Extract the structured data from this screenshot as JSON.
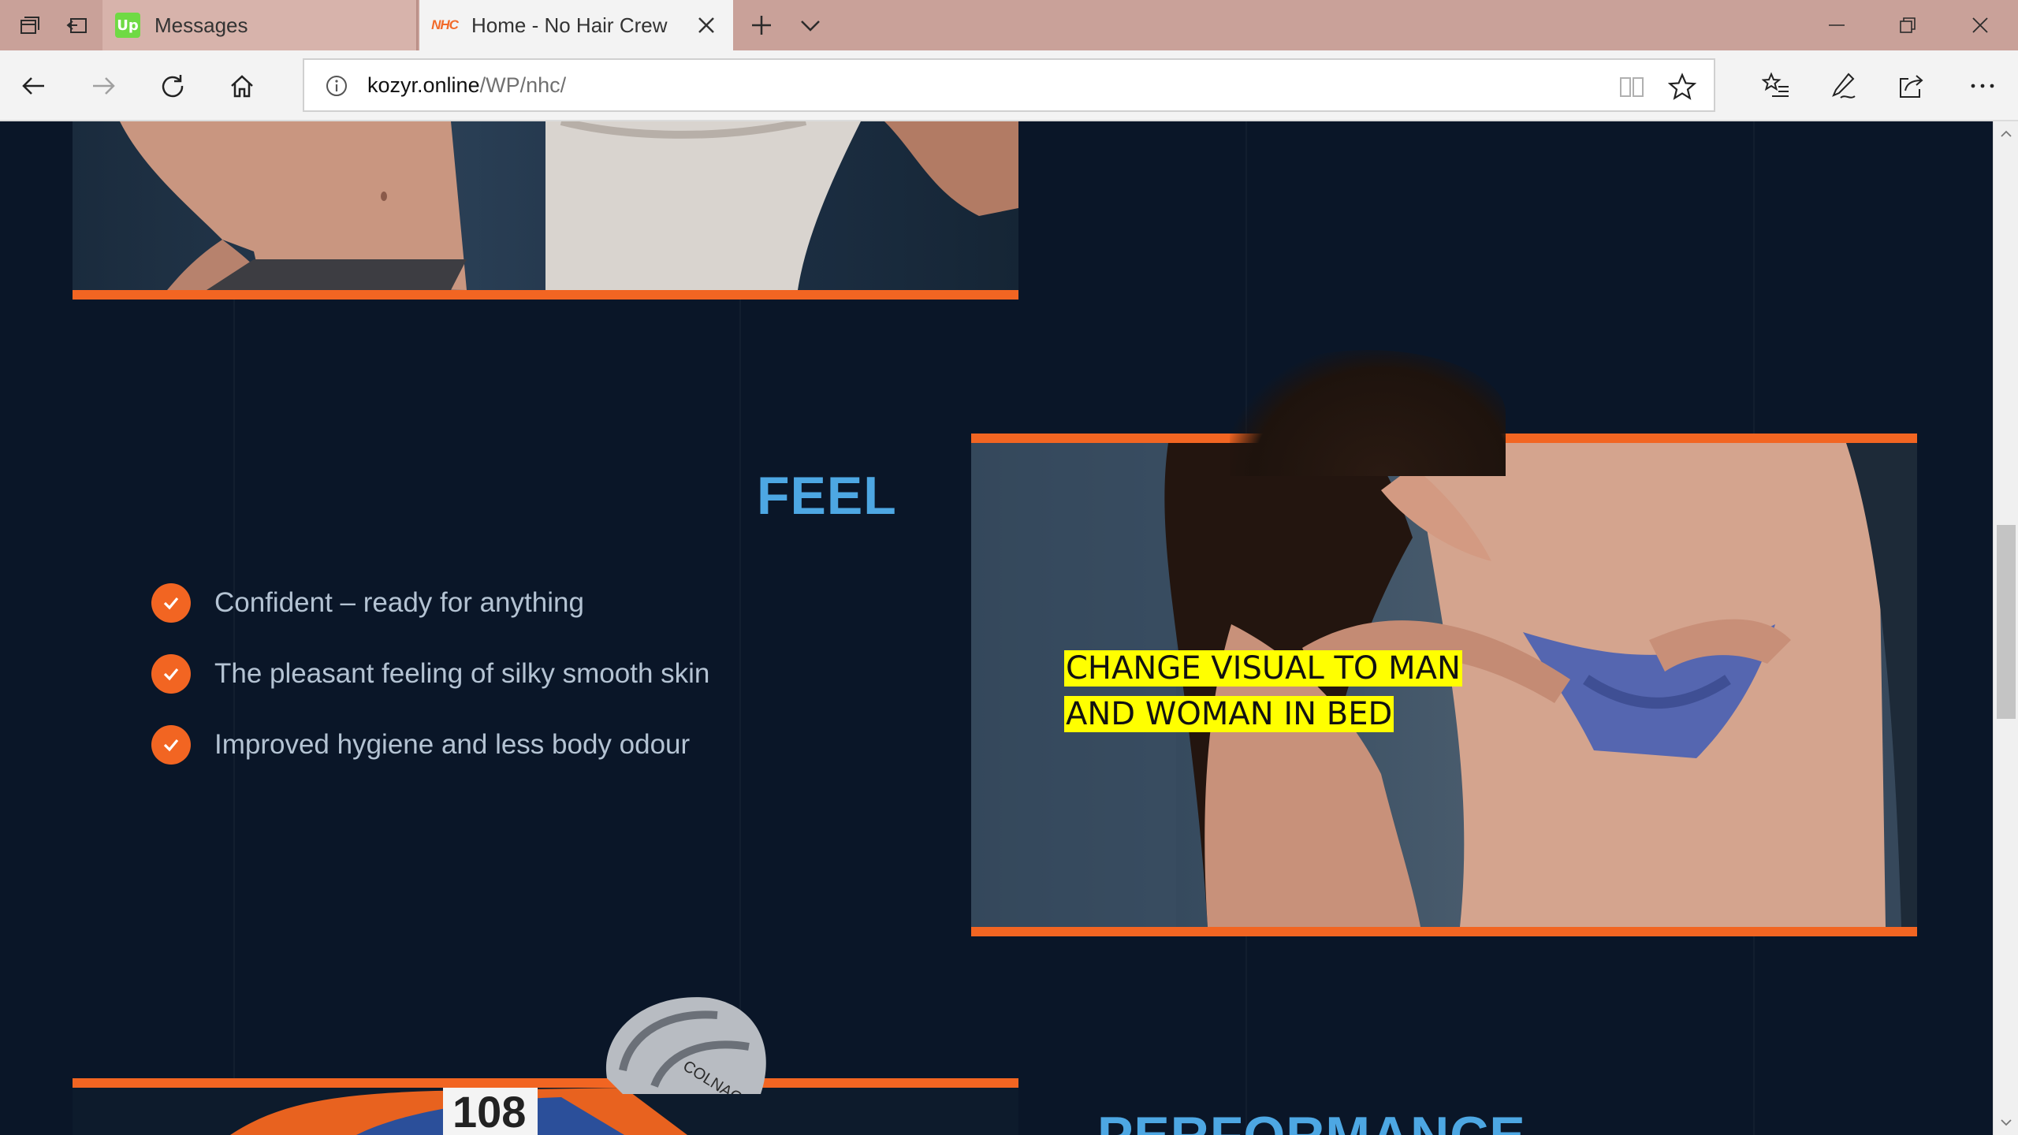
{
  "browser": {
    "tabs": [
      {
        "title": "Messages",
        "favicon": "upwork-icon",
        "favicon_text": "Up",
        "active": false
      },
      {
        "title": "Home - No Hair Crew",
        "favicon": "nhc-icon",
        "favicon_text": "NHC",
        "active": true
      }
    ],
    "address": {
      "domain": "kozyr.online",
      "path": "/WP/nhc/"
    }
  },
  "page": {
    "feel_section": {
      "title": "FEEL",
      "bullets": [
        "Confident – ready for anything",
        "The pleasant feeling of silky smooth skin",
        "Improved hygiene and less body odour"
      ]
    },
    "annotation": {
      "line1": "CHANGE VISUAL TO MAN",
      "line2": "AND WOMAN IN BED"
    },
    "bottom_image": {
      "bib_number": "108",
      "helmet_brand": "COLNAGO"
    },
    "next_section_title": "PERFORMANCE"
  },
  "colors": {
    "accent_orange": "#f26522",
    "title_blue": "#4da7e3",
    "page_background": "#0a1628",
    "annotation_highlight": "#ffff00",
    "tabbar": "#c9a199"
  }
}
